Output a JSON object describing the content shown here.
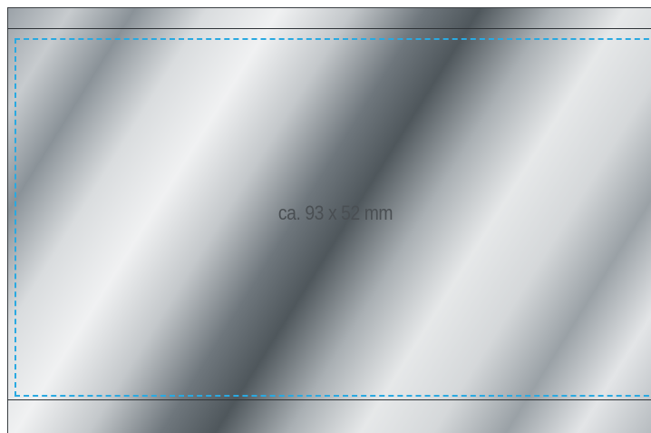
{
  "label": {
    "dimensions": "ca. 93 x 52 mm"
  },
  "colors": {
    "safe_line": "#29a9e1",
    "trim_line": "#2f3438",
    "text": "#4a4f53"
  }
}
